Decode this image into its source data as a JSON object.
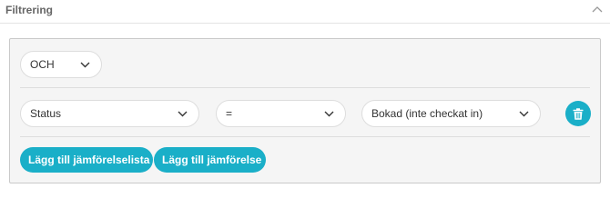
{
  "section": {
    "title": "Filtrering"
  },
  "logic_operator": {
    "selected": "OCH"
  },
  "condition": {
    "field": "Status",
    "comparator": "=",
    "value": "Bokad (inte checkat in)"
  },
  "buttons": {
    "add_comparison_list": "Lägg till jämförelselista",
    "add_comparison": "Lägg till jämförelse"
  },
  "colors": {
    "accent": "#1aafc8",
    "panel_bg": "#f5f5f5",
    "panel_border": "#c9c9c9"
  },
  "icons": {
    "collapse": "chevron-up-icon",
    "dropdown": "chevron-down-icon",
    "delete": "trash-icon"
  }
}
